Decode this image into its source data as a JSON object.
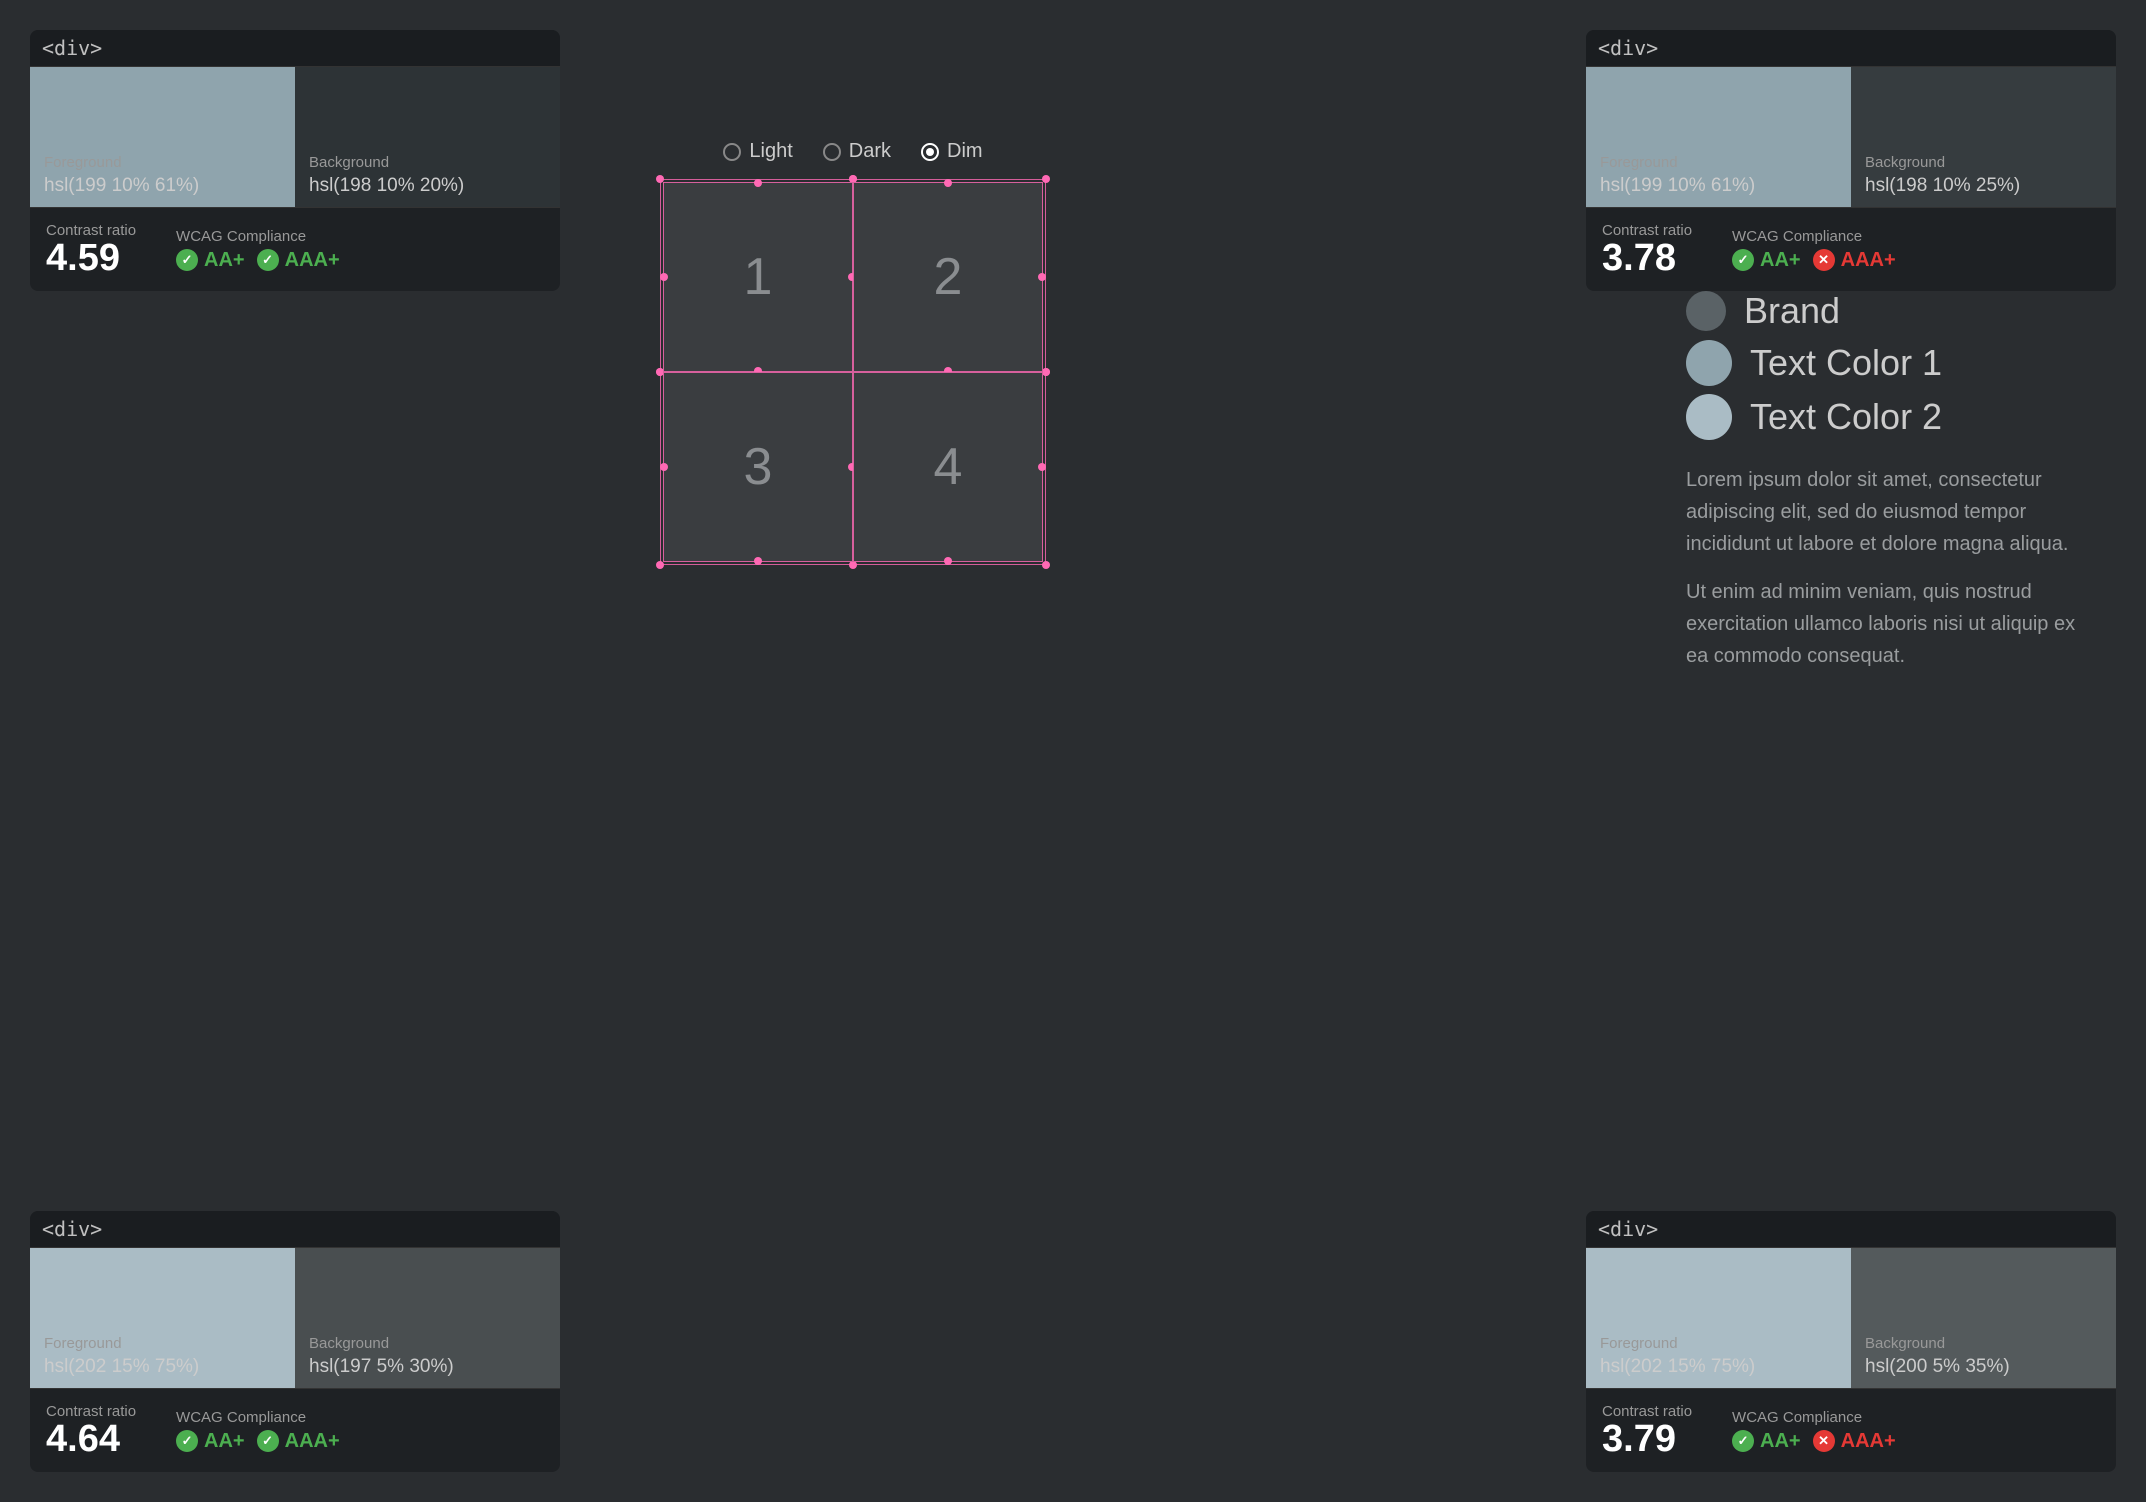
{
  "panels": {
    "top_left": {
      "tag": "<div>",
      "foreground_label": "Foreground",
      "foreground_value": "hsl(199 10% 61%)",
      "foreground_color": "#8fa4ad",
      "background_label": "Background",
      "background_value": "hsl(198 10% 20%)",
      "background_color": "#2d3336",
      "contrast_label": "Contrast ratio",
      "contrast_value": "4.59",
      "wcag_label": "WCAG Compliance",
      "aa_label": "AA+",
      "aaa_label": "AAA+",
      "aa_pass": true,
      "aaa_pass": true
    },
    "top_right": {
      "tag": "<div>",
      "foreground_label": "Foreground",
      "foreground_value": "hsl(199 10% 61%)",
      "foreground_color": "#8fa4ad",
      "background_label": "Background",
      "background_value": "hsl(198 10% 25%)",
      "background_color": "#363c3f",
      "contrast_label": "Contrast ratio",
      "contrast_value": "3.78",
      "wcag_label": "WCAG Compliance",
      "aa_label": "AA+",
      "aaa_label": "AAA+",
      "aa_pass": true,
      "aaa_pass": false
    },
    "bottom_left": {
      "tag": "<div>",
      "foreground_label": "Foreground",
      "foreground_value": "hsl(202 15% 75%)",
      "foreground_color": "#aabcc5",
      "background_label": "Background",
      "background_value": "hsl(197 5% 30%)",
      "background_color": "#494e50",
      "contrast_label": "Contrast ratio",
      "contrast_value": "4.64",
      "wcag_label": "WCAG Compliance",
      "aa_label": "AA+",
      "aaa_label": "AAA+",
      "aa_pass": true,
      "aaa_pass": true
    },
    "bottom_right": {
      "tag": "<div>",
      "foreground_label": "Foreground",
      "foreground_value": "hsl(202 15% 75%)",
      "foreground_color": "#aabcc5",
      "background_label": "Background",
      "background_value": "hsl(200 5% 35%)",
      "background_color": "#545a5c",
      "contrast_label": "Contrast ratio",
      "contrast_value": "3.79",
      "wcag_label": "WCAG Compliance",
      "aa_label": "AA+",
      "aaa_label": "AAA+",
      "aa_pass": true,
      "aaa_pass": false
    }
  },
  "radio": {
    "options": [
      "Light",
      "Dark",
      "Dim"
    ],
    "selected": "Dim"
  },
  "grid": {
    "cells": [
      "1",
      "2",
      "3",
      "4"
    ]
  },
  "legend": {
    "items": [
      {
        "label": "Brand",
        "color": "#5a6266"
      },
      {
        "label": "Text Color 1",
        "color": "#8fa4ad"
      },
      {
        "label": "Text Color 2",
        "color": "#aabcc5"
      }
    ]
  },
  "lorem": {
    "p1": "Lorem ipsum dolor sit amet, consectetur adipiscing elit, sed do eiusmod tempor incididunt ut labore et dolore magna aliqua.",
    "p2": "Ut enim ad minim veniam, quis nostrud exercitation ullamco laboris nisi ut aliquip ex ea commodo consequat."
  }
}
